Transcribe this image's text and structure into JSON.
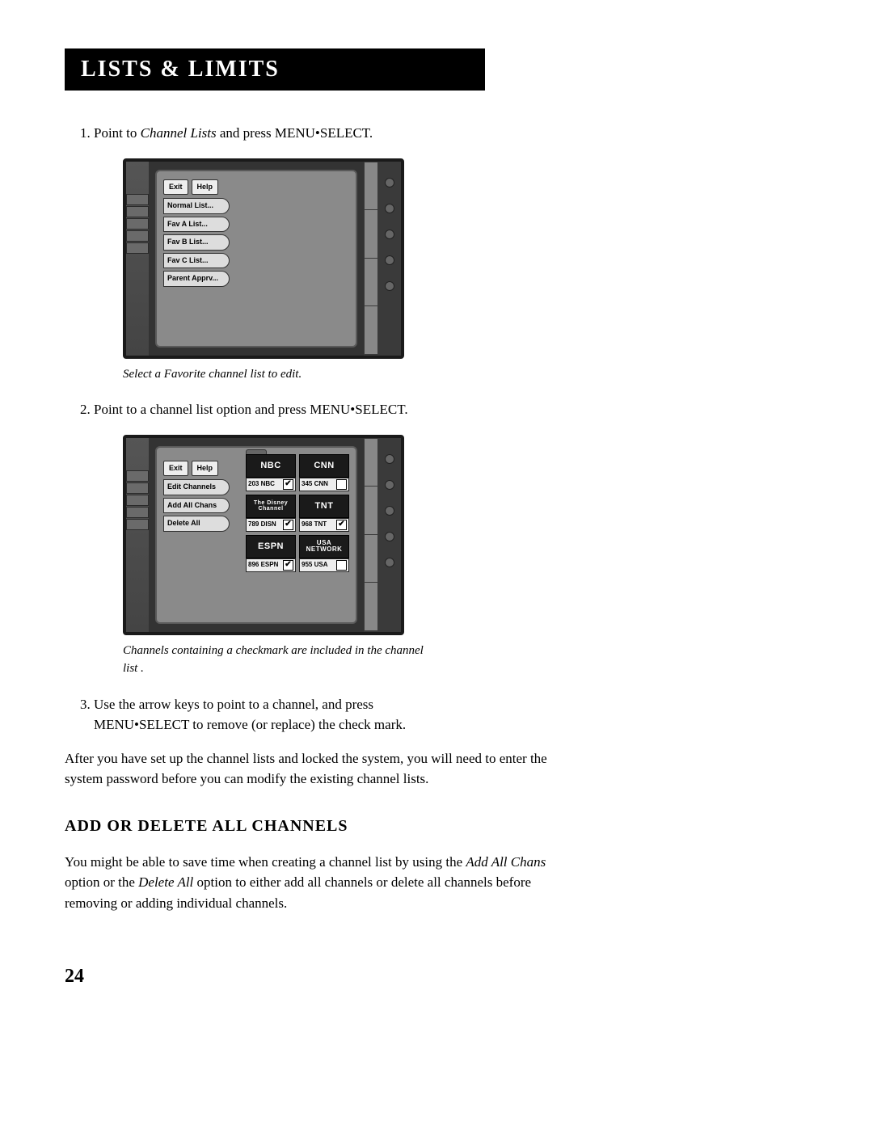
{
  "header": {
    "title": "LISTS & LIMITS"
  },
  "steps": {
    "1": {
      "pre": "Point to ",
      "italic": "Channel Lists",
      "post": " and press MENU•SELECT."
    },
    "2": "Point to a channel list option and press MENU•SELECT.",
    "3a": "Use the arrow keys to point to a channel, and press",
    "3b": "MENU•SELECT to remove (or replace) the check mark."
  },
  "captions": {
    "fig1": "Select a Favorite channel list to edit.",
    "fig2": "Channels containing a checkmark are included in the channel list ."
  },
  "tv1": {
    "top_row": [
      "Exit",
      "Help"
    ],
    "tabs": [
      "Normal List...",
      "Fav A List...",
      "Fav B List...",
      "Fav C List...",
      "Parent Apprv..."
    ]
  },
  "tv2": {
    "top_row": [
      "Exit",
      "Help"
    ],
    "tabs": [
      "Edit Channels",
      "Add All Chans",
      "Delete All"
    ],
    "channels": [
      {
        "logo": "NBC",
        "num": "203",
        "code": "NBC",
        "checked": true
      },
      {
        "logo": "CNN",
        "num": "345",
        "code": "CNN",
        "checked": false
      },
      {
        "logo": "The Disney Channel",
        "num": "789",
        "code": "DISN",
        "checked": true
      },
      {
        "logo": "TNT",
        "num": "968",
        "code": "TNT",
        "checked": true
      },
      {
        "logo": "ESPN",
        "num": "896",
        "code": "ESPN",
        "checked": true
      },
      {
        "logo": "USA NETWORK",
        "num": "955",
        "code": "USA",
        "checked": false
      }
    ]
  },
  "body_para": "After you have set up the channel lists and locked the system, you will need to enter the system password before you can modify the existing channel lists.",
  "sub_heading": "ADD OR DELETE ALL CHANNELS",
  "sub_para": {
    "pre": "You might be able to save time when creating a channel list by using the ",
    "i1": "Add All Chans",
    "mid": " option or the ",
    "i2": "Delete All",
    "post": " option to either add all channels or delete all channels before removing or adding individual channels."
  },
  "page_number": "24"
}
